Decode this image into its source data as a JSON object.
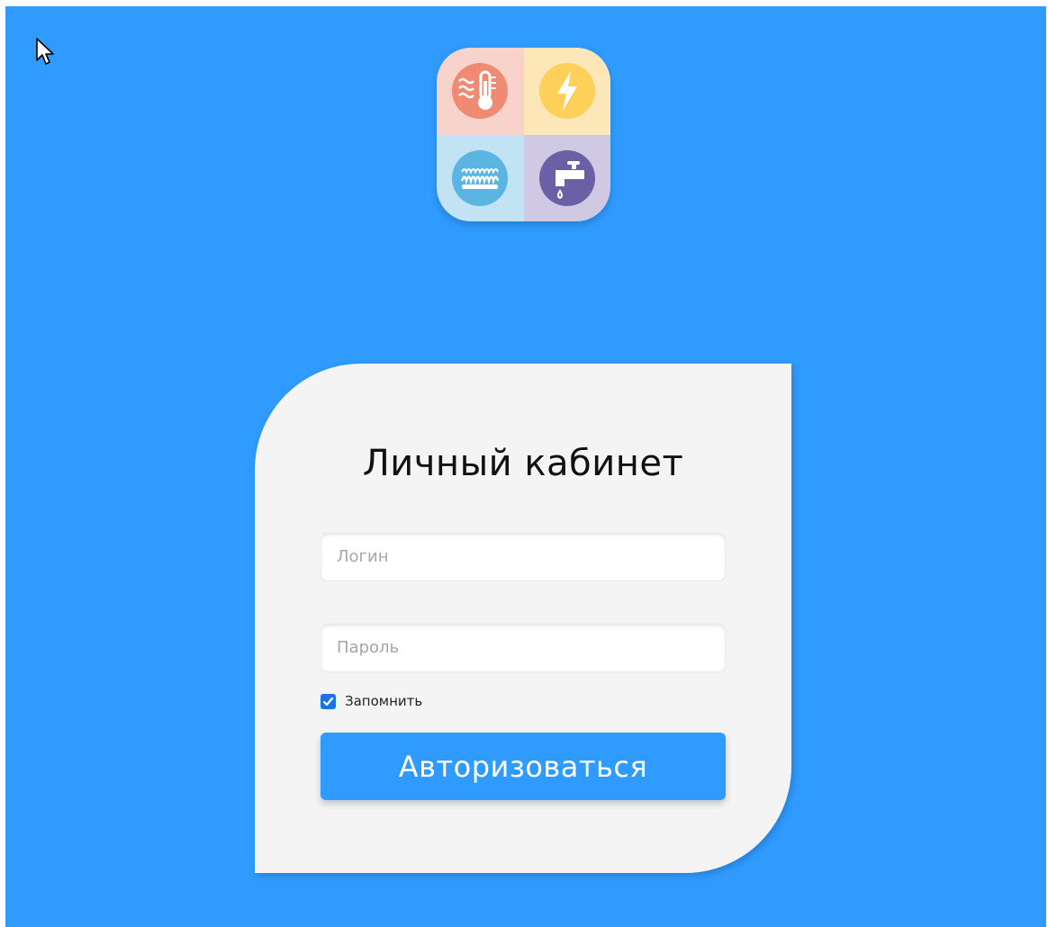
{
  "app": {
    "logo_icons": [
      "thermometer-icon",
      "lightning-icon",
      "gas-flame-icon",
      "water-tap-icon"
    ],
    "colors": {
      "background": "#2f9bff",
      "card": "#f4f4f4",
      "heat": "#f08a72",
      "power": "#fdd05a",
      "gas": "#5ab5e2",
      "water": "#6b5fa6",
      "accent": "#2f9bff"
    }
  },
  "login": {
    "title": "Личный кабинет",
    "login_field": {
      "placeholder": "Логин",
      "value": ""
    },
    "password_field": {
      "placeholder": "Пароль",
      "value": ""
    },
    "remember": {
      "label": "Запомнить",
      "checked": true
    },
    "submit_label": "Авторизоваться"
  }
}
